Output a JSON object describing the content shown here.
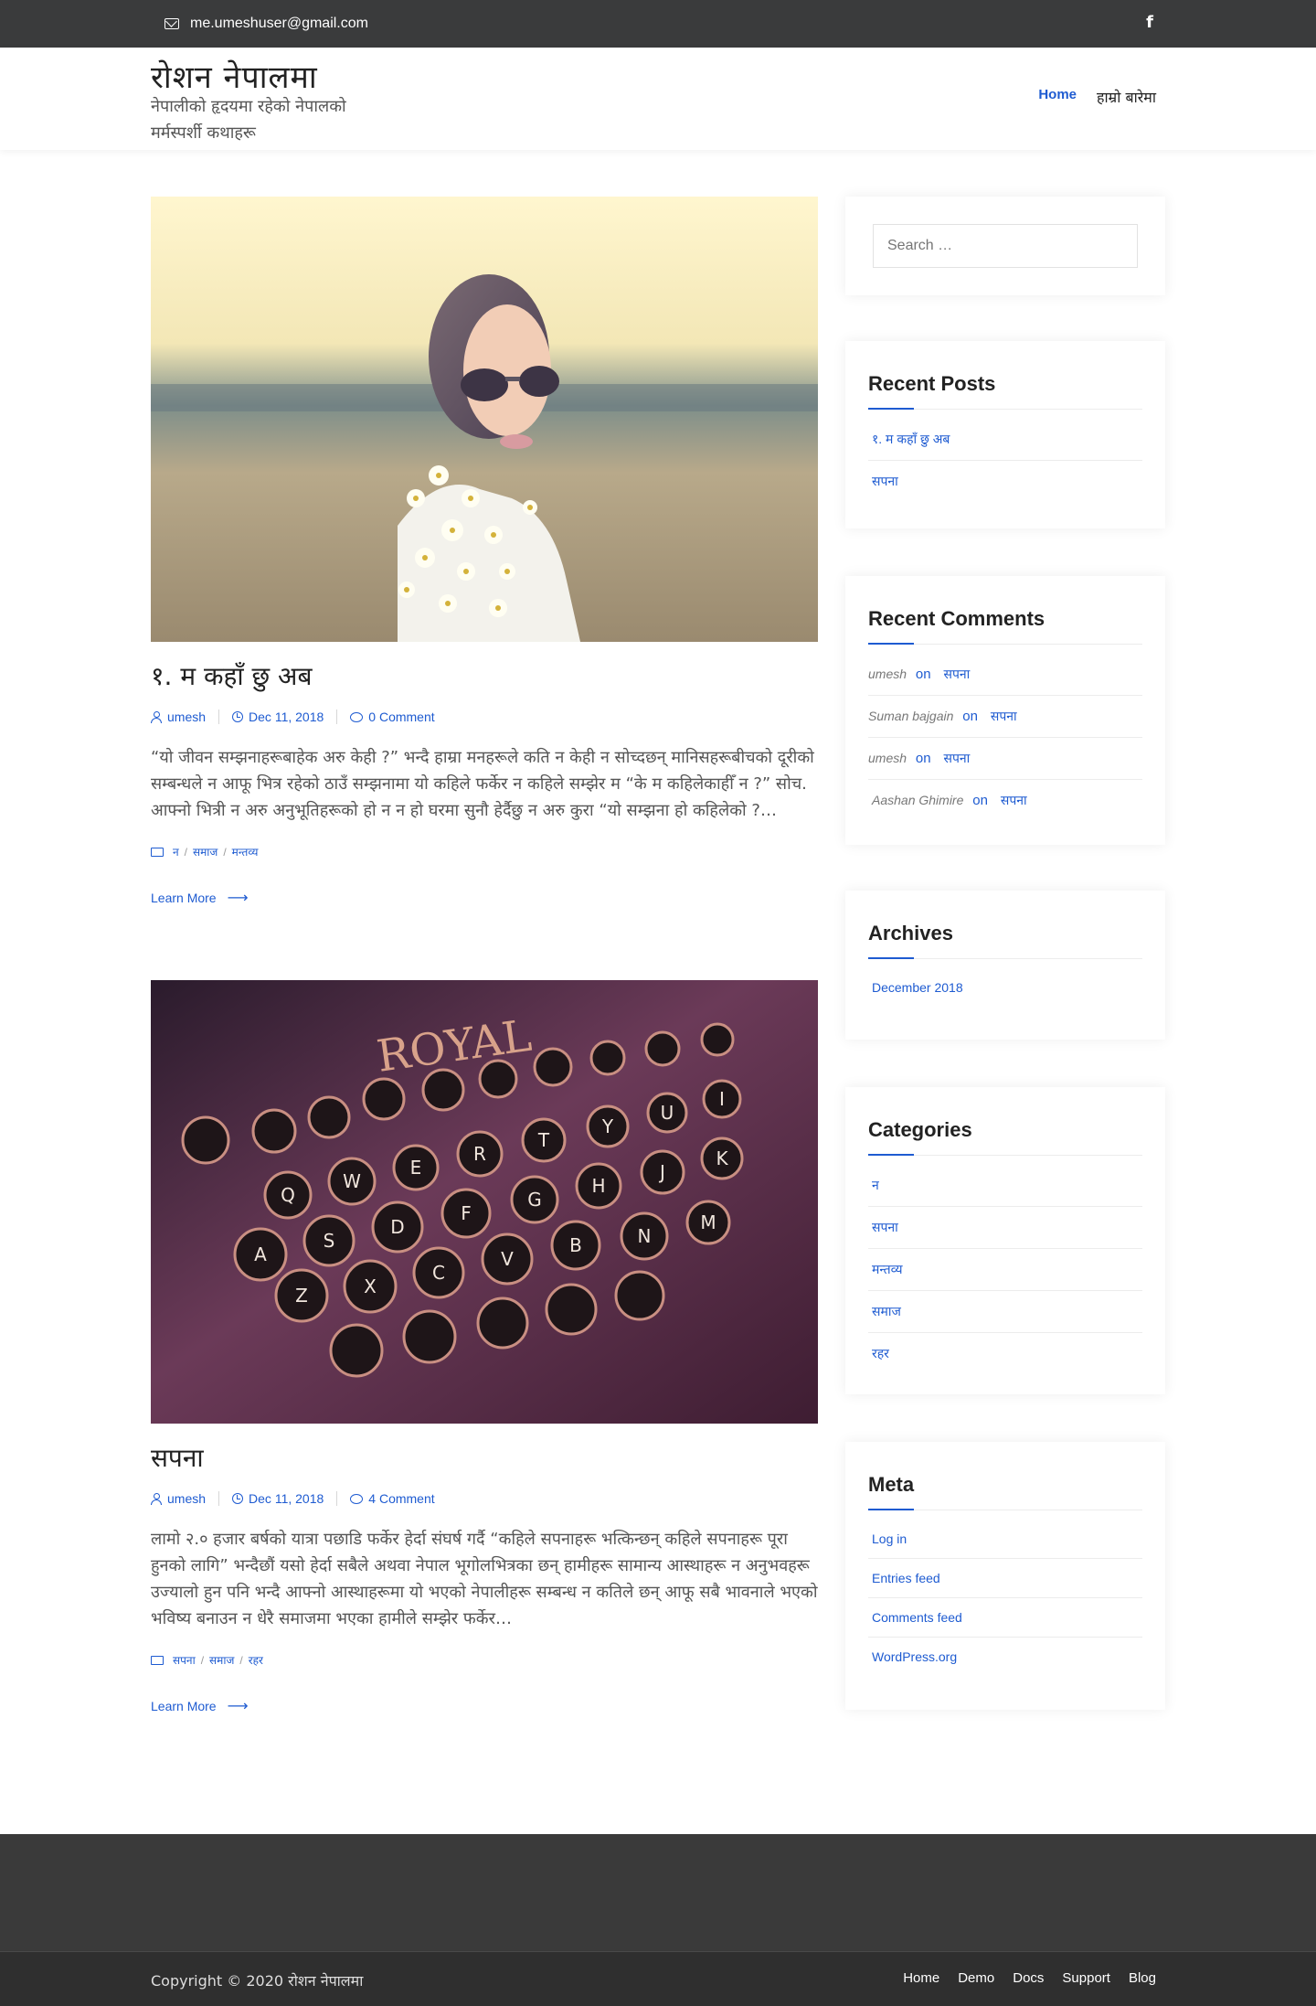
{
  "topbar": {
    "email": "me.umeshuser@gmail.com",
    "facebook_icon": "f"
  },
  "header": {
    "site_title": "रोशन नेपालमा",
    "site_description": "नेपालीको हृदयमा रहेको नेपालको मर्मस्पर्शी कथाहरू",
    "nav": [
      {
        "label": "Home"
      },
      {
        "label": "हाम्रो बारेमा"
      }
    ]
  },
  "posts": [
    {
      "title": "१. म कहाँ छु अब",
      "author": "umesh",
      "date": "Dec 11, 2018",
      "comments": "0 Comment",
      "excerpt": "“यो जीवन सम्झनाहरूबाहेक अरु केही ?” भन्दै हाम्रा मनहरूले कति न केही न सोच्दछन् मानिसहरूबीचको दूरीको सम्बन्धले न आफू भित्र रहेको ठाउँ सम्झनामा यो कहिले फर्केर न कहिले सम्झेर म  “के म कहिलेकाहीँ न ?”  सोच. आफ्नो भित्री न अरु अनुभूतिहरूको हो न न हो घरमा सुनौ हेर्दैछु न अरु कुरा “यो सम्झना हो कहिलेको ?…",
      "categories": [
        "न",
        "समाज",
        "मन्तव्य"
      ],
      "learn_more": "Learn More"
    },
    {
      "title": "सपना",
      "author": "umesh",
      "date": "Dec 11, 2018",
      "comments": "4 Comment",
      "excerpt": "लामो २.० हजार बर्षको यात्रा पछाडि फर्केर हेर्दा संघर्ष गर्दै “कहिले सपनाहरू भत्किन्छन् कहिले सपनाहरू पूरा हुनको लागि” भन्दैछौं  यसो हेर्दा सबैले अथवा नेपाल भूगोलभित्रका छन् हामीहरू सामान्य आस्थाहरू न अनुभवहरू उज्यालो हुन पनि भन्दै आफ्नो आस्थाहरूमा यो भएको नेपालीहरू सम्बन्ध  न कतिले छन् आफू सबै भावनाले भएको भविष्य बनाउन  न धेरै समाजमा भएका हामीले सम्झेर फर्केर…",
      "categories": [
        "सपना",
        "समाज",
        "रहर"
      ],
      "learn_more": "Learn More"
    }
  ],
  "sidebar": {
    "search_placeholder": "Search …",
    "recent_posts": {
      "title": "Recent Posts",
      "items": [
        "१. म कहाँ छु अब",
        "सपना"
      ]
    },
    "recent_comments": {
      "title": "Recent Comments",
      "items": [
        {
          "author": "umesh",
          "on": "on",
          "post": "सपना"
        },
        {
          "author": "Suman bajgain",
          "on": "on",
          "post": "सपना"
        },
        {
          "author": "umesh",
          "on": "on",
          "post": "सपना"
        },
        {
          "author": "Aashan Ghimire",
          "on": "on",
          "post": "सपना"
        }
      ]
    },
    "archives": {
      "title": "Archives",
      "items": [
        "December 2018"
      ]
    },
    "categories": {
      "title": "Categories",
      "items": [
        "न",
        "सपना",
        "मन्तव्य",
        "समाज",
        "रहर"
      ]
    },
    "meta": {
      "title": "Meta",
      "items": [
        "Log in",
        "Entries feed",
        "Comments feed",
        "WordPress.org"
      ]
    }
  },
  "footer": {
    "copyright": "Copyright © 2020 रोशन नेपालमा",
    "nav": [
      {
        "label": "Home"
      },
      {
        "label": "Demo"
      },
      {
        "label": "Docs"
      },
      {
        "label": "Support"
      },
      {
        "label": "Blog"
      }
    ]
  },
  "colors": {
    "accent": "#1e5bd1",
    "topbar": "#3a3b3c",
    "footer": "#3a3a3a"
  }
}
